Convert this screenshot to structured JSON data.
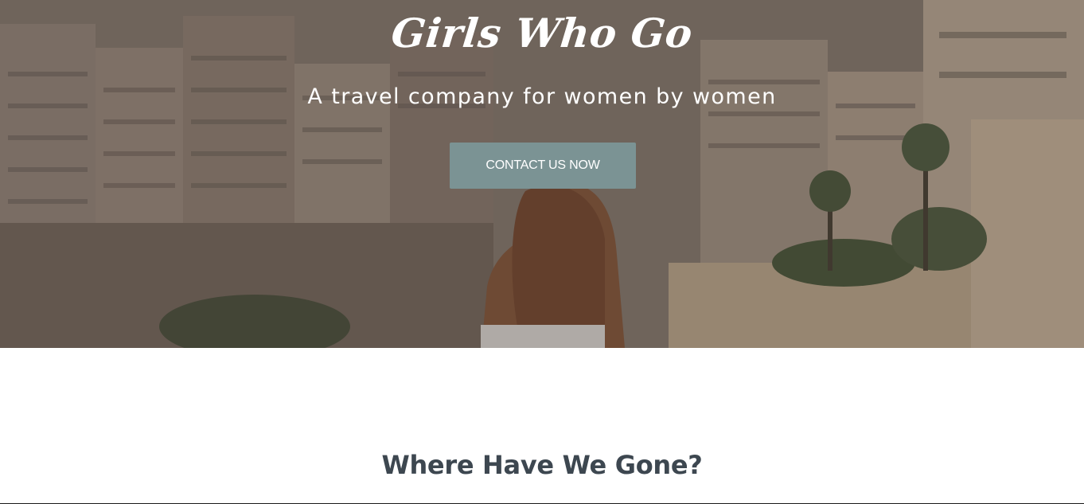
{
  "hero": {
    "title": "Girls Who Go",
    "subtitle": "A travel company for women by women",
    "cta_label": "CONTACT US NOW"
  },
  "section": {
    "title": "Where Have We Gone?"
  },
  "colors": {
    "cta_background": "#7b9394",
    "hero_text": "#ffffff",
    "section_title": "#3d4750",
    "page_background": "#ffffff"
  }
}
